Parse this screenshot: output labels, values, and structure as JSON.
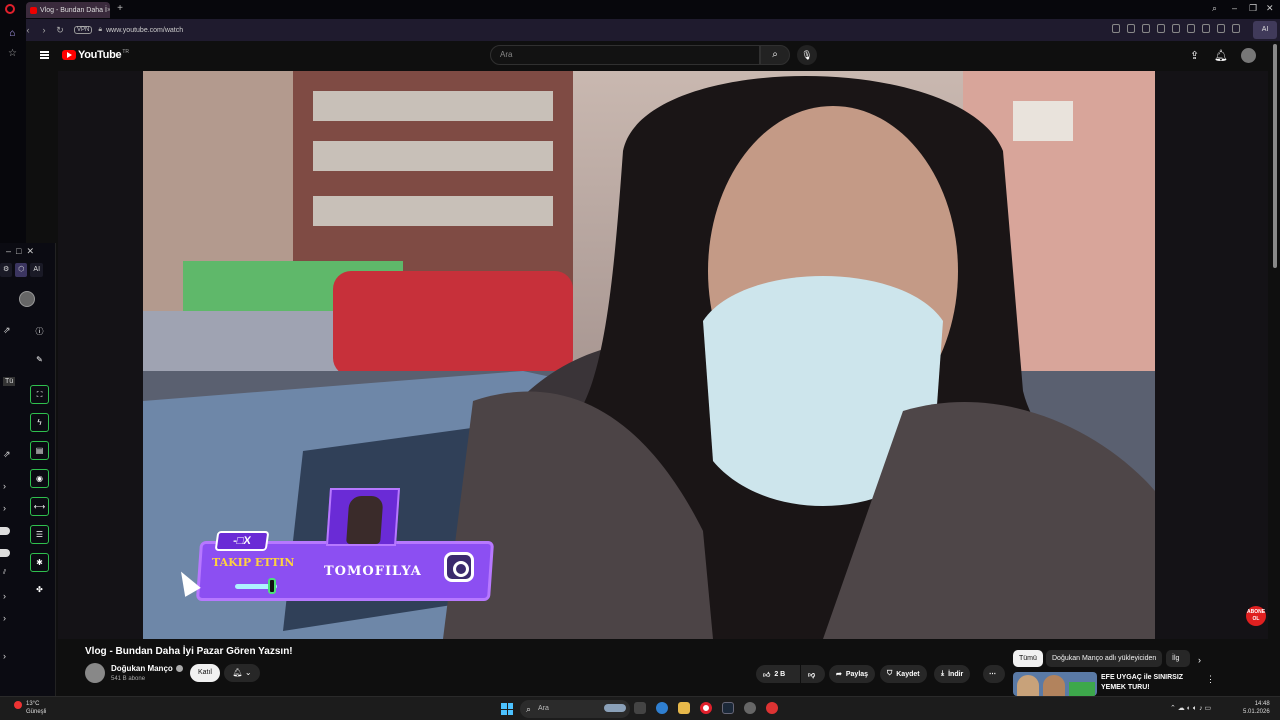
{
  "browser": {
    "tab_title": "Vlog - Bundan Daha İ",
    "url": "www.youtube.com/watch",
    "vpn_label": "VPN",
    "ai_label": "AI"
  },
  "panel": {
    "tab_label": "AI",
    "left_label_1": "Tü"
  },
  "youtube": {
    "logo_text": "YouTube",
    "logo_region": "TR",
    "search_placeholder": "Ara"
  },
  "video": {
    "overlay_follow_text": "TAKIP ETTIN",
    "overlay_name": "TOMOFILYA",
    "overlay_window_text": "-□X",
    "subscribe_badge": "ABONE OL"
  },
  "info": {
    "title": "Vlog - Bundan Daha İyi Pazar Gören Yazsın!",
    "channel_name": "Doğukan Manço",
    "subscribers": "541 B abone",
    "join_label": "Katıl",
    "likes": "2 B",
    "share_label": "Paylaş",
    "save_label": "Kaydet",
    "download_label": "İndir"
  },
  "chips": [
    "Tümü",
    "Doğukan Manço adlı yükleyiciden",
    "İlg"
  ],
  "recommendation": {
    "title": "EFE UYGAÇ ile SINIRSIZ YEMEK TURU!"
  },
  "taskbar": {
    "weather_temp": "13°C",
    "weather_desc": "Güneşli",
    "search_placeholder": "Ara",
    "time": "14:48",
    "date": "5.01.2026"
  }
}
